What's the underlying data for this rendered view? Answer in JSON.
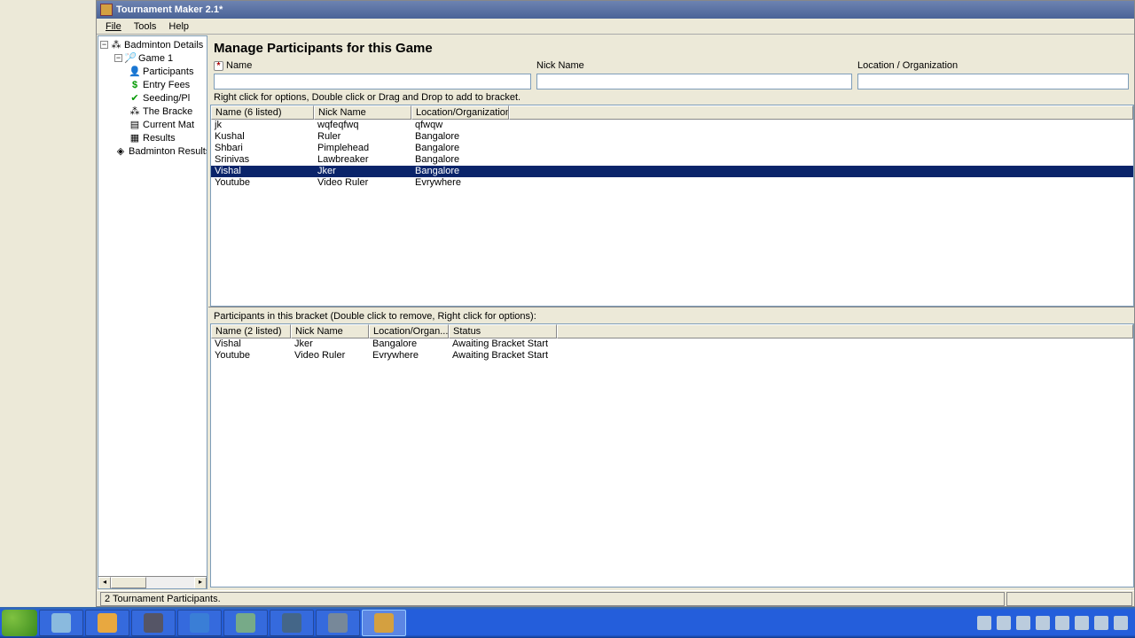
{
  "app": {
    "title": "Tournament Maker 2.1*"
  },
  "menu": {
    "file": "File",
    "tools": "Tools",
    "help": "Help"
  },
  "tree": {
    "root": "Badminton Details",
    "game": "Game 1",
    "items": [
      "Participants",
      "Entry Fees",
      "Seeding/Pl",
      "The Bracke",
      "Current Mat",
      "Results"
    ],
    "results_root": "Badminton Results"
  },
  "page": {
    "title": "Manage Participants for this Game",
    "name_label": "Name",
    "nick_label": "Nick Name",
    "loc_label": "Location / Organization",
    "hint": "Right click for options, Double click or Drag and Drop to add to bracket.",
    "bracket_label": "Participants in this bracket (Double click to remove, Right click for options):"
  },
  "top_table": {
    "cols": {
      "name": "Name (6 listed)",
      "nick": "Nick Name",
      "loc": "Location/Organization"
    },
    "widths": {
      "name": 116,
      "nick": 110,
      "loc": 110
    },
    "rows": [
      {
        "name": "jk",
        "nick": "wqfeqfwq",
        "loc": "qfwqw",
        "sel": false
      },
      {
        "name": "Kushal",
        "nick": "Ruler",
        "loc": "Bangalore",
        "sel": false
      },
      {
        "name": "Shbari",
        "nick": "Pimplehead",
        "loc": "Bangalore",
        "sel": false
      },
      {
        "name": "Srinivas",
        "nick": "Lawbreaker",
        "loc": "Bangalore",
        "sel": false
      },
      {
        "name": "Vishal",
        "nick": "Jker",
        "loc": "Bangalore",
        "sel": true
      },
      {
        "name": "Youtube",
        "nick": "Video Ruler",
        "loc": "Evrywhere",
        "sel": false
      }
    ]
  },
  "bottom_table": {
    "cols": {
      "name": "Name (2 listed)",
      "nick": "Nick Name",
      "loc": "Location/Organ...",
      "status": "Status"
    },
    "widths": {
      "name": 90,
      "nick": 88,
      "loc": 90,
      "status": 122
    },
    "rows": [
      {
        "name": "Vishal",
        "nick": "Jker",
        "loc": "Bangalore",
        "status": "Awaiting Bracket Start"
      },
      {
        "name": "Youtube",
        "nick": "Video Ruler",
        "loc": "Evrywhere",
        "status": "Awaiting Bracket Start"
      }
    ]
  },
  "status": {
    "text": "2 Tournament Participants."
  }
}
